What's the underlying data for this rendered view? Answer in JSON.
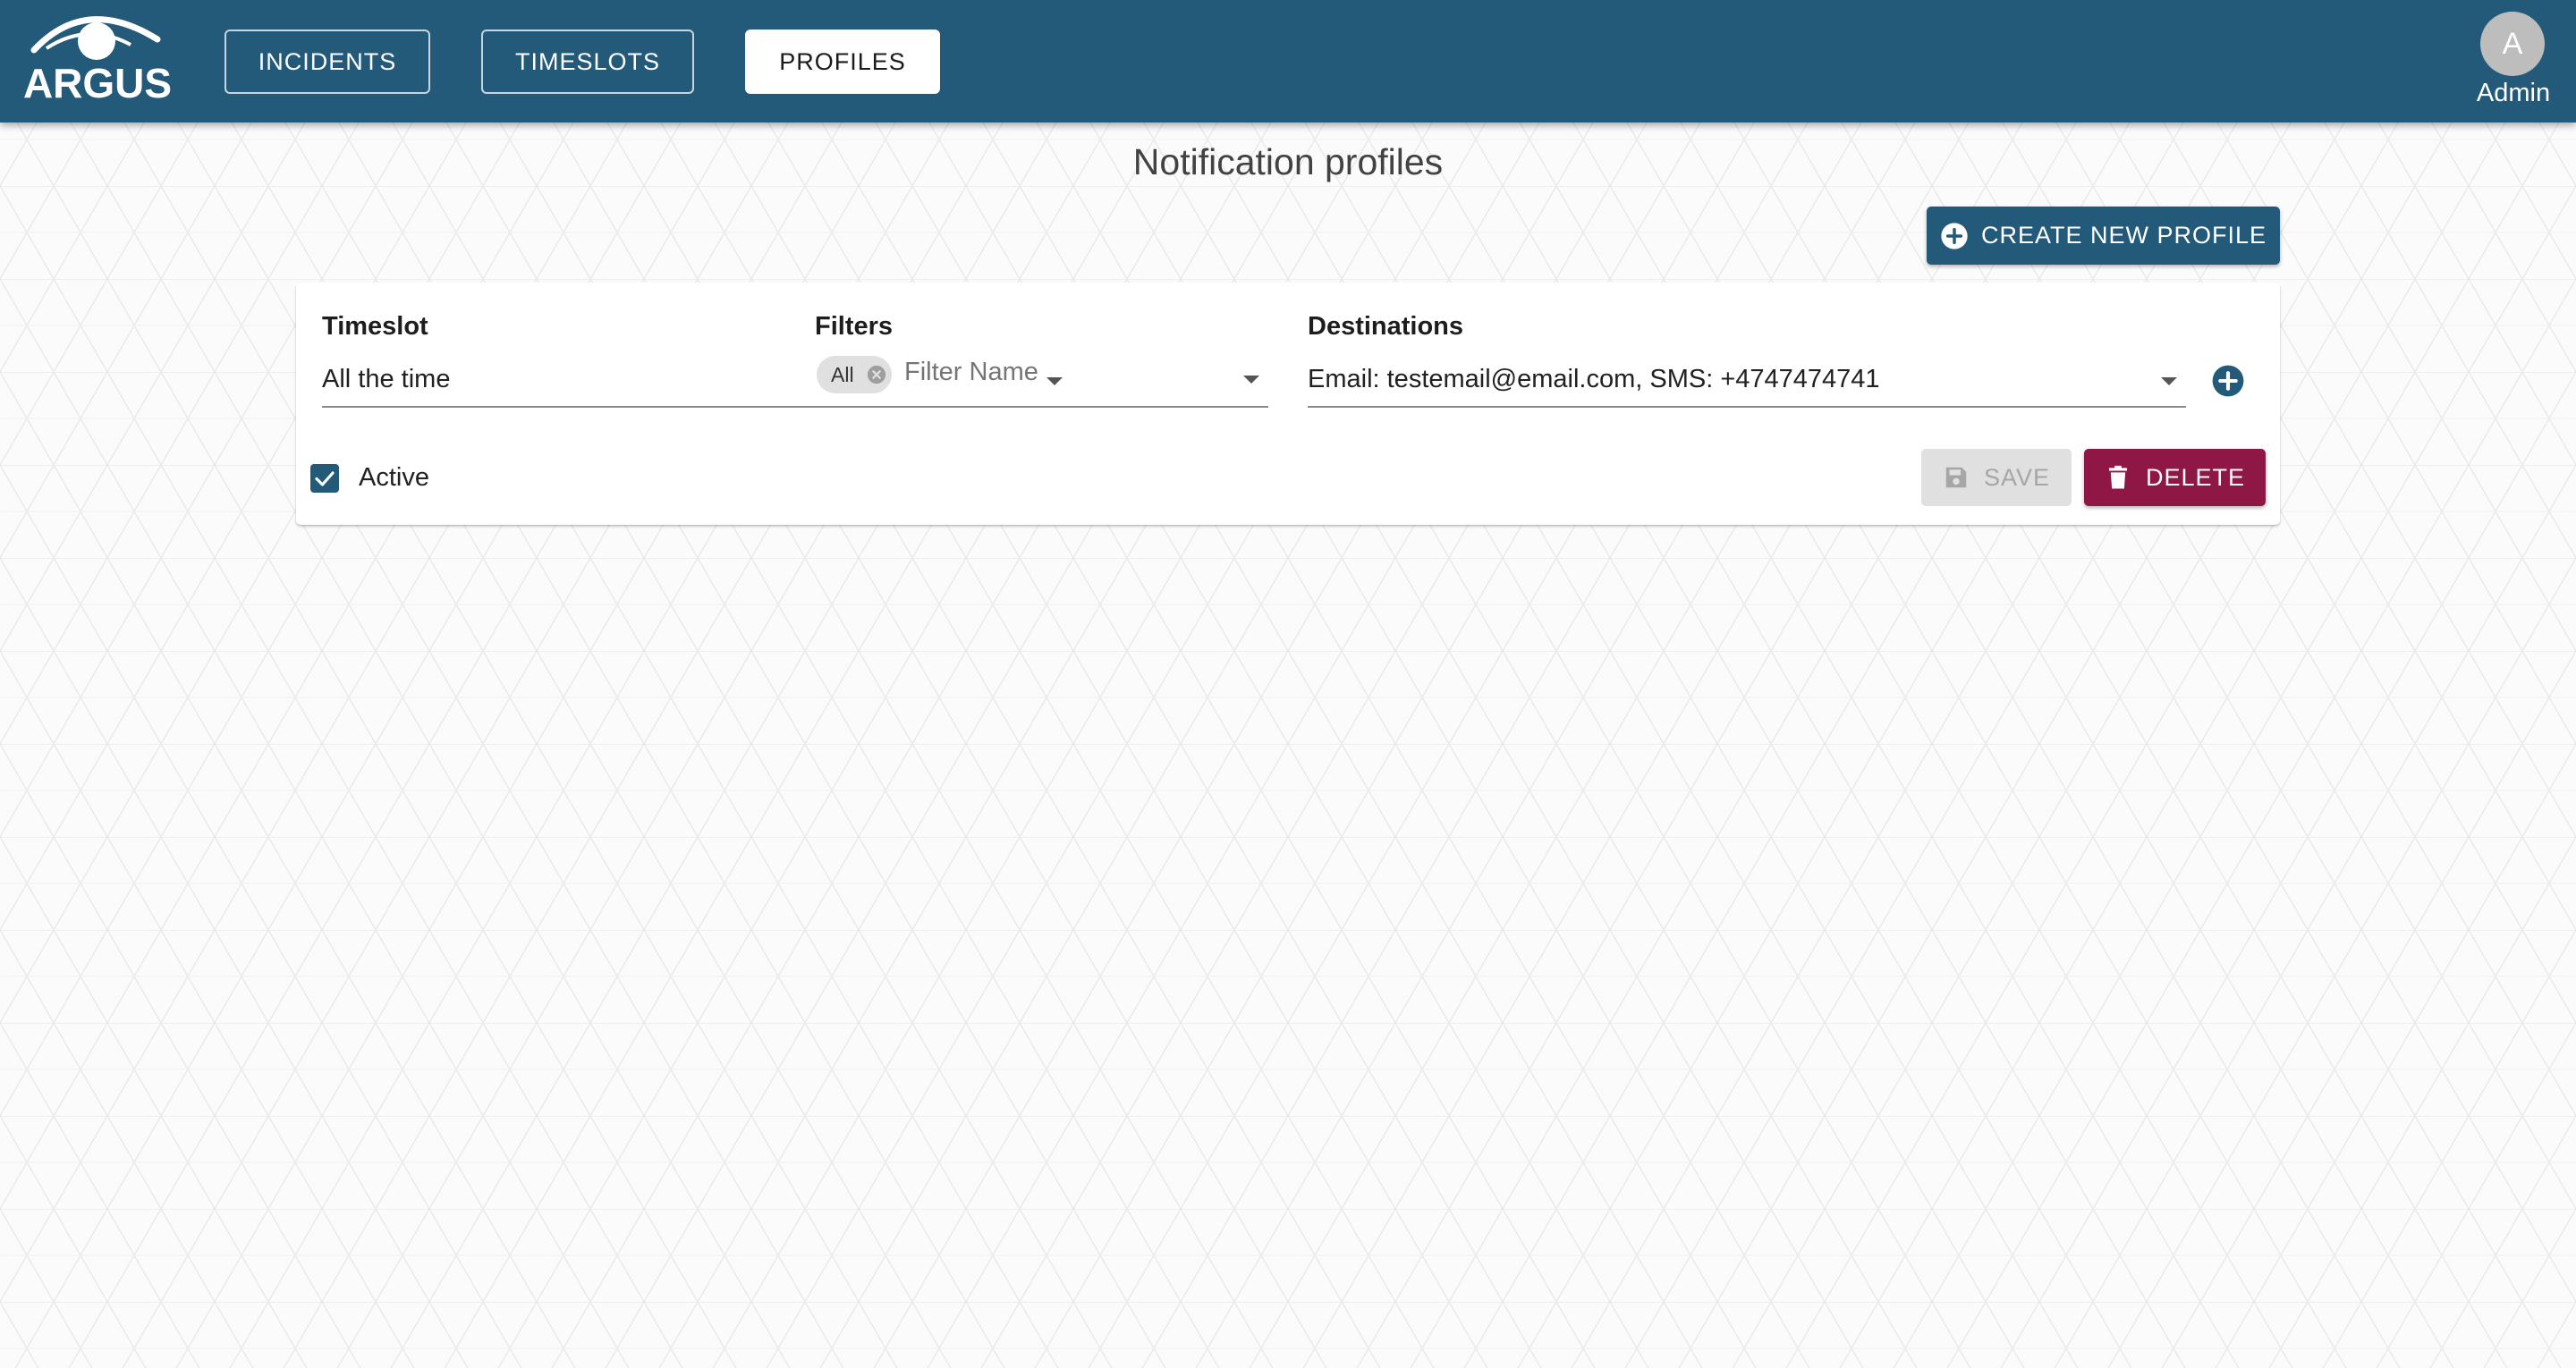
{
  "app": {
    "logo_text": "ARGUS",
    "nav": [
      {
        "label": "INCIDENTS",
        "active": false
      },
      {
        "label": "TIMESLOTS",
        "active": false
      },
      {
        "label": "PROFILES",
        "active": true
      }
    ],
    "user": {
      "initial": "A",
      "name": "Admin"
    }
  },
  "colors": {
    "header": "#245a79",
    "primary": "#245a79",
    "danger": "#8e1746",
    "disabled": "#e0e0e0"
  },
  "page": {
    "title": "Notification profiles",
    "create_button": {
      "label": "CREATE NEW PROFILE",
      "icon": "add-circle-icon"
    }
  },
  "profile": {
    "timeslot": {
      "label": "Timeslot",
      "value": "All the time"
    },
    "filters": {
      "label": "Filters",
      "chips": [
        "All"
      ],
      "placeholder": "Filter Name"
    },
    "destinations": {
      "label": "Destinations",
      "value": "Email: testemail@email.com, SMS: +4747474741",
      "add_icon": "add-circle-icon"
    },
    "active": {
      "label": "Active",
      "checked": true
    },
    "save_button": {
      "label": "SAVE",
      "disabled": true,
      "icon": "save-icon"
    },
    "delete_button": {
      "label": "DELETE",
      "icon": "trash-icon"
    }
  }
}
